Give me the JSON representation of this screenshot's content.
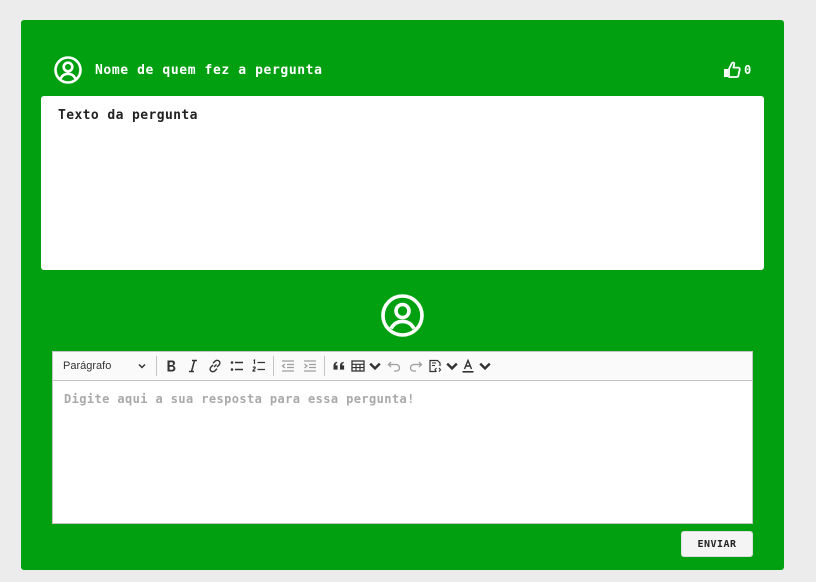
{
  "question": {
    "author_name": "Nome de quem fez a pergunta",
    "text": "Texto da pergunta",
    "like_count": "0",
    "like_icon": "thumbs-up-icon",
    "avatar_icon": "user-circle-icon"
  },
  "answer": {
    "avatar_icon": "user-circle-icon",
    "editor": {
      "heading_select": "Parágrafo",
      "placeholder": "Digite aqui a sua resposta para essa pergunta!",
      "toolbar_icons": [
        "bold-icon",
        "italic-icon",
        "link-icon",
        "bulleted-list-icon",
        "numbered-list-icon",
        "outdent-icon",
        "indent-icon",
        "blockquote-icon",
        "table-icon",
        "undo-icon",
        "redo-icon",
        "source-editing-icon",
        "font-color-icon"
      ]
    },
    "submit_label": "ENVIAR"
  },
  "colors": {
    "card_background": "#00a010",
    "page_background": "#ececec",
    "panel_background": "#ffffff",
    "placeholder_text": "#a9a9a9"
  }
}
